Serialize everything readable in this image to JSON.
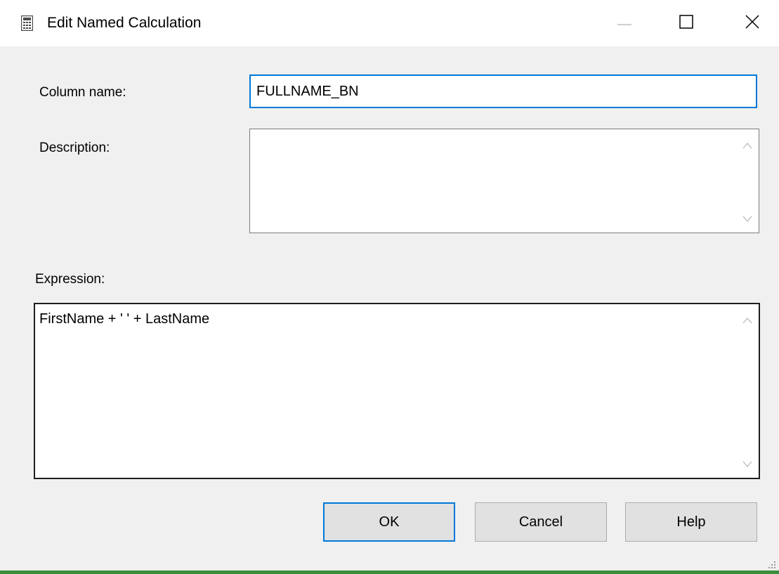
{
  "window": {
    "title": "Edit Named Calculation",
    "icon": "calculator-icon",
    "controls": {
      "minimize_icon": "minimize-icon",
      "maximize_icon": "maximize-icon",
      "close_icon": "close-icon"
    }
  },
  "form": {
    "column_name_label": "Column name:",
    "column_name_value": "FULLNAME_BN",
    "description_label": "Description:",
    "description_value": "",
    "expression_label": "Expression:",
    "expression_value": "FirstName + ' ' + LastName"
  },
  "buttons": {
    "ok_label": "OK",
    "cancel_label": "Cancel",
    "help_label": "Help"
  },
  "colors": {
    "accent": "#0078d7",
    "dialog_bg": "#f0f0f0",
    "titlebar_bg": "#ffffff",
    "button_bg": "#e1e1e1",
    "bottom_strip": "#3c8d3c"
  }
}
